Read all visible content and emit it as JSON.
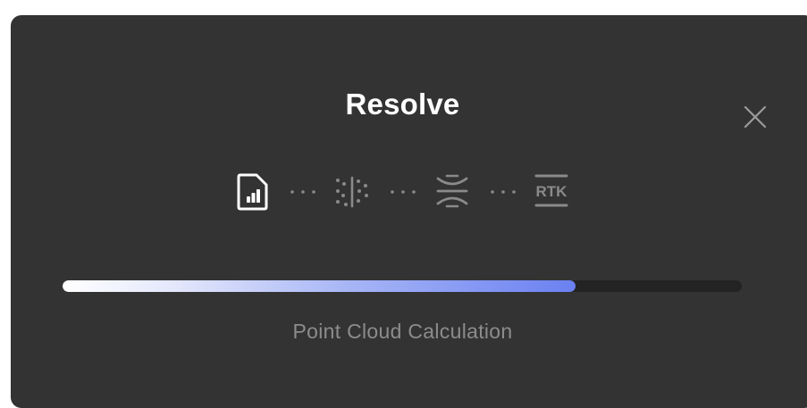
{
  "dialog": {
    "title": "Resolve",
    "close_icon": "close-icon",
    "steps": [
      {
        "icon": "document-chart-icon",
        "state": "active"
      },
      {
        "icon": "point-cloud-icon",
        "state": "pending"
      },
      {
        "icon": "align-merge-icon",
        "state": "pending"
      },
      {
        "icon": "rtk-icon",
        "label": "RTK",
        "state": "pending"
      }
    ],
    "progress": 0.755,
    "status_text": "Point Cloud Calculation"
  },
  "colors": {
    "background": "#333333",
    "active_icon": "#ffffff",
    "inactive_icon": "#8a8a8a",
    "progress_start": "#ffffff",
    "progress_end": "#6b80f2",
    "track": "#232323",
    "status_text": "#8c8c8c"
  }
}
